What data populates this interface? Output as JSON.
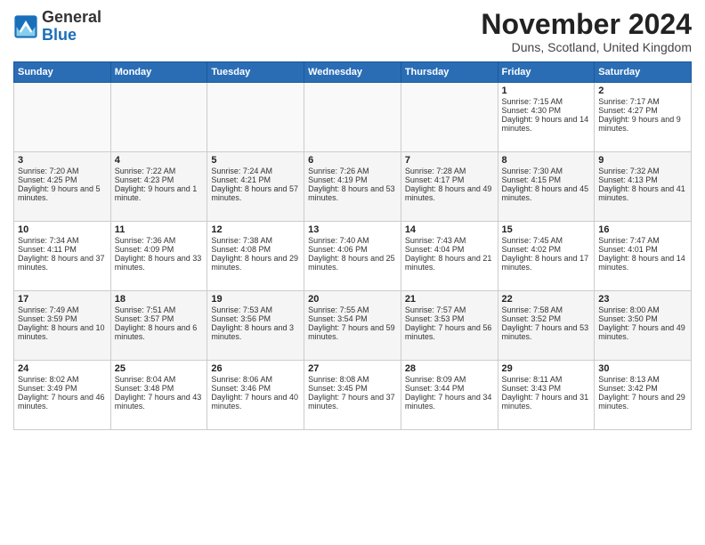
{
  "header": {
    "logo_general": "General",
    "logo_blue": "Blue",
    "month_title": "November 2024",
    "location": "Duns, Scotland, United Kingdom"
  },
  "days_of_week": [
    "Sunday",
    "Monday",
    "Tuesday",
    "Wednesday",
    "Thursday",
    "Friday",
    "Saturday"
  ],
  "weeks": [
    [
      {
        "day": "",
        "info": ""
      },
      {
        "day": "",
        "info": ""
      },
      {
        "day": "",
        "info": ""
      },
      {
        "day": "",
        "info": ""
      },
      {
        "day": "",
        "info": ""
      },
      {
        "day": "1",
        "info": "Sunrise: 7:15 AM\nSunset: 4:30 PM\nDaylight: 9 hours and 14 minutes."
      },
      {
        "day": "2",
        "info": "Sunrise: 7:17 AM\nSunset: 4:27 PM\nDaylight: 9 hours and 9 minutes."
      }
    ],
    [
      {
        "day": "3",
        "info": "Sunrise: 7:20 AM\nSunset: 4:25 PM\nDaylight: 9 hours and 5 minutes."
      },
      {
        "day": "4",
        "info": "Sunrise: 7:22 AM\nSunset: 4:23 PM\nDaylight: 9 hours and 1 minute."
      },
      {
        "day": "5",
        "info": "Sunrise: 7:24 AM\nSunset: 4:21 PM\nDaylight: 8 hours and 57 minutes."
      },
      {
        "day": "6",
        "info": "Sunrise: 7:26 AM\nSunset: 4:19 PM\nDaylight: 8 hours and 53 minutes."
      },
      {
        "day": "7",
        "info": "Sunrise: 7:28 AM\nSunset: 4:17 PM\nDaylight: 8 hours and 49 minutes."
      },
      {
        "day": "8",
        "info": "Sunrise: 7:30 AM\nSunset: 4:15 PM\nDaylight: 8 hours and 45 minutes."
      },
      {
        "day": "9",
        "info": "Sunrise: 7:32 AM\nSunset: 4:13 PM\nDaylight: 8 hours and 41 minutes."
      }
    ],
    [
      {
        "day": "10",
        "info": "Sunrise: 7:34 AM\nSunset: 4:11 PM\nDaylight: 8 hours and 37 minutes."
      },
      {
        "day": "11",
        "info": "Sunrise: 7:36 AM\nSunset: 4:09 PM\nDaylight: 8 hours and 33 minutes."
      },
      {
        "day": "12",
        "info": "Sunrise: 7:38 AM\nSunset: 4:08 PM\nDaylight: 8 hours and 29 minutes."
      },
      {
        "day": "13",
        "info": "Sunrise: 7:40 AM\nSunset: 4:06 PM\nDaylight: 8 hours and 25 minutes."
      },
      {
        "day": "14",
        "info": "Sunrise: 7:43 AM\nSunset: 4:04 PM\nDaylight: 8 hours and 21 minutes."
      },
      {
        "day": "15",
        "info": "Sunrise: 7:45 AM\nSunset: 4:02 PM\nDaylight: 8 hours and 17 minutes."
      },
      {
        "day": "16",
        "info": "Sunrise: 7:47 AM\nSunset: 4:01 PM\nDaylight: 8 hours and 14 minutes."
      }
    ],
    [
      {
        "day": "17",
        "info": "Sunrise: 7:49 AM\nSunset: 3:59 PM\nDaylight: 8 hours and 10 minutes."
      },
      {
        "day": "18",
        "info": "Sunrise: 7:51 AM\nSunset: 3:57 PM\nDaylight: 8 hours and 6 minutes."
      },
      {
        "day": "19",
        "info": "Sunrise: 7:53 AM\nSunset: 3:56 PM\nDaylight: 8 hours and 3 minutes."
      },
      {
        "day": "20",
        "info": "Sunrise: 7:55 AM\nSunset: 3:54 PM\nDaylight: 7 hours and 59 minutes."
      },
      {
        "day": "21",
        "info": "Sunrise: 7:57 AM\nSunset: 3:53 PM\nDaylight: 7 hours and 56 minutes."
      },
      {
        "day": "22",
        "info": "Sunrise: 7:58 AM\nSunset: 3:52 PM\nDaylight: 7 hours and 53 minutes."
      },
      {
        "day": "23",
        "info": "Sunrise: 8:00 AM\nSunset: 3:50 PM\nDaylight: 7 hours and 49 minutes."
      }
    ],
    [
      {
        "day": "24",
        "info": "Sunrise: 8:02 AM\nSunset: 3:49 PM\nDaylight: 7 hours and 46 minutes."
      },
      {
        "day": "25",
        "info": "Sunrise: 8:04 AM\nSunset: 3:48 PM\nDaylight: 7 hours and 43 minutes."
      },
      {
        "day": "26",
        "info": "Sunrise: 8:06 AM\nSunset: 3:46 PM\nDaylight: 7 hours and 40 minutes."
      },
      {
        "day": "27",
        "info": "Sunrise: 8:08 AM\nSunset: 3:45 PM\nDaylight: 7 hours and 37 minutes."
      },
      {
        "day": "28",
        "info": "Sunrise: 8:09 AM\nSunset: 3:44 PM\nDaylight: 7 hours and 34 minutes."
      },
      {
        "day": "29",
        "info": "Sunrise: 8:11 AM\nSunset: 3:43 PM\nDaylight: 7 hours and 31 minutes."
      },
      {
        "day": "30",
        "info": "Sunrise: 8:13 AM\nSunset: 3:42 PM\nDaylight: 7 hours and 29 minutes."
      }
    ]
  ]
}
